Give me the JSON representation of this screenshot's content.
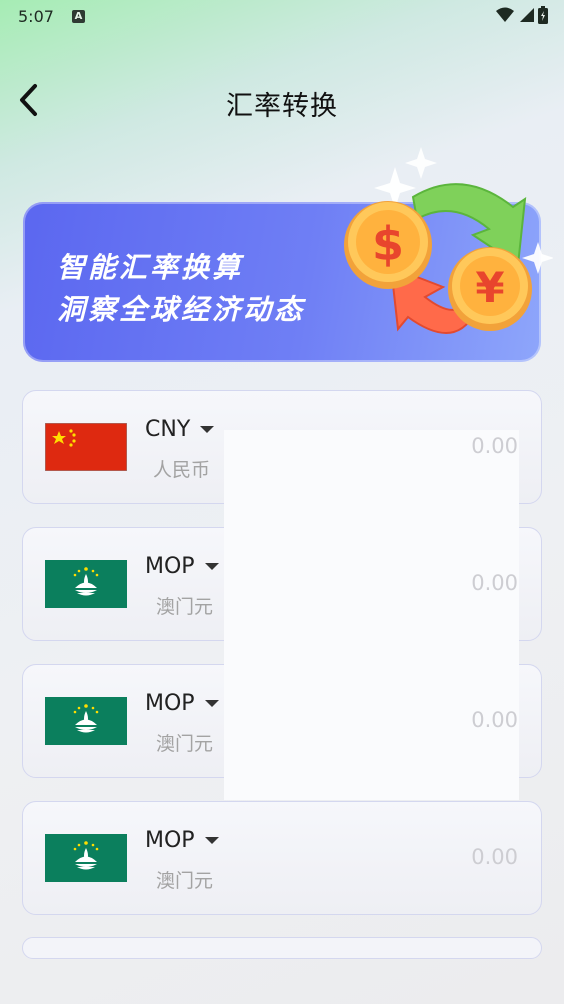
{
  "status_bar": {
    "time": "5:07",
    "a_icon": "A"
  },
  "header": {
    "title": "汇率转换",
    "back_icon": "chevron-left-icon"
  },
  "banner": {
    "line1": "智能汇率换算",
    "line2": "洞察全球经济动态"
  },
  "currencies": [
    {
      "code": "CNY",
      "name": "人民币",
      "amount": "0.00",
      "flag": "china-flag"
    },
    {
      "code": "MOP",
      "name": "澳门元",
      "amount": "0.00",
      "flag": "macau-flag"
    },
    {
      "code": "MOP",
      "name": "澳门元",
      "amount": "0.00",
      "flag": "macau-flag"
    },
    {
      "code": "MOP",
      "name": "澳门元",
      "amount": "0.00",
      "flag": "macau-flag"
    }
  ],
  "colors": {
    "banner": "#6f7ff5",
    "macau_green": "#0b7f5d",
    "china_red": "#de2910"
  }
}
